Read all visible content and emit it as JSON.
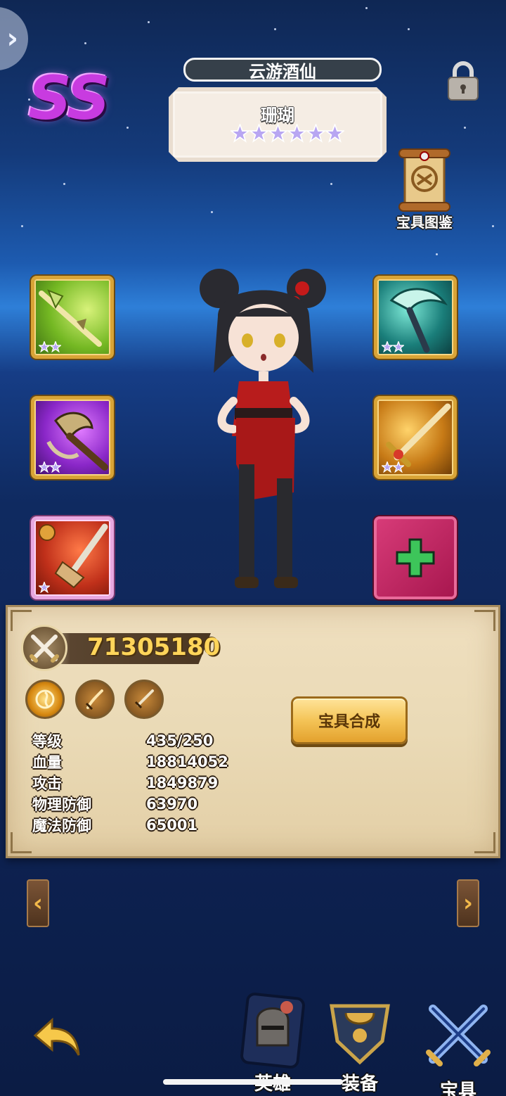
{
  "header": {
    "rank": "SS",
    "title": "云游酒仙",
    "hero_name": "珊瑚",
    "hero_stars": 6,
    "codex_label": "宝具图鉴"
  },
  "slots": [
    {
      "name": "green-spear",
      "stars": 2,
      "color": "#74b823"
    },
    {
      "name": "purple-axe",
      "stars": 2,
      "color": "#8a27c8"
    },
    {
      "name": "red-blade",
      "stars": 1,
      "color": "#c0301a"
    },
    {
      "name": "teal-scythe",
      "stars": 2,
      "color": "#1a7e7a"
    },
    {
      "name": "golden-sword",
      "stars": 2,
      "color": "#c77a16"
    }
  ],
  "panel": {
    "power": "71305180",
    "forge_button": "宝具合成",
    "stats": [
      {
        "label": "等级",
        "value": "435/250"
      },
      {
        "label": "血量",
        "value": "18814052"
      },
      {
        "label": "攻击",
        "value": "1849879"
      },
      {
        "label": "物理防御",
        "value": "63970"
      },
      {
        "label": "魔法防御",
        "value": "65001"
      }
    ]
  },
  "nav": {
    "hero": "英雄",
    "gear": "装备",
    "treasure": "宝具"
  },
  "icons": {
    "top_left": "chevron-right-icon",
    "lock": "padlock-icon",
    "prev": "chevron-left-icon",
    "next": "chevron-right-icon",
    "back": "return-arrow-icon",
    "add": "plus-icon"
  },
  "colors": {
    "star_fill": "#b8a6f2",
    "gold": "#ffd55a",
    "rank_purple": "#c83be0",
    "add_slot": "#c4255f"
  }
}
